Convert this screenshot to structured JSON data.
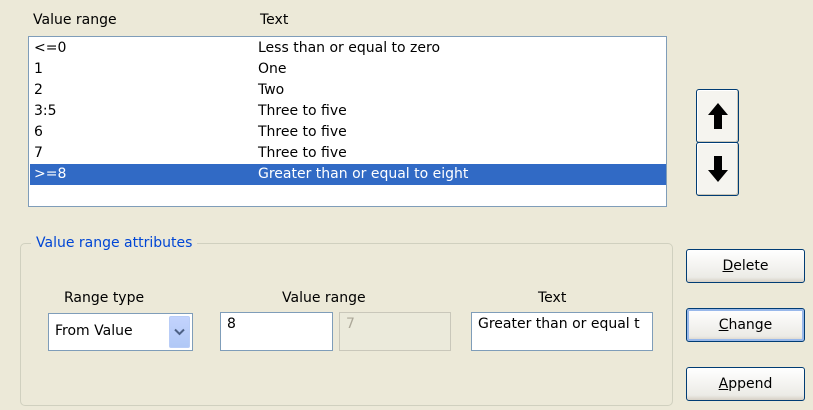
{
  "list": {
    "columns": [
      "Value range",
      "Text"
    ],
    "rows": [
      {
        "range": "<=0",
        "text": "Less than or equal to zero",
        "selected": false
      },
      {
        "range": "1",
        "text": "One",
        "selected": false
      },
      {
        "range": "2",
        "text": "Two",
        "selected": false
      },
      {
        "range": "3:5",
        "text": "Three to five",
        "selected": false
      },
      {
        "range": "6",
        "text": "Three to five",
        "selected": false
      },
      {
        "range": "7",
        "text": "Three to five",
        "selected": false
      },
      {
        "range": ">=8",
        "text": "Greater than or equal to eight",
        "selected": true
      }
    ]
  },
  "arrows": {
    "up_icon": "arrow-up",
    "down_icon": "arrow-down"
  },
  "attributes": {
    "legend": "Value range attributes",
    "range_type_label": "Range type",
    "value_range_label": "Value range",
    "text_label": "Text",
    "range_type_value": "From Value",
    "value_from": "8",
    "value_to": "7",
    "text_value": "Greater than or equal t"
  },
  "buttons": {
    "delete_mnemonic": "D",
    "delete_rest": "elete",
    "change_mnemonic": "C",
    "change_rest": "hange",
    "append_mnemonic": "A",
    "append_rest": "ppend"
  },
  "colors": {
    "selection": "#316ac5",
    "legend": "#0046d5"
  }
}
